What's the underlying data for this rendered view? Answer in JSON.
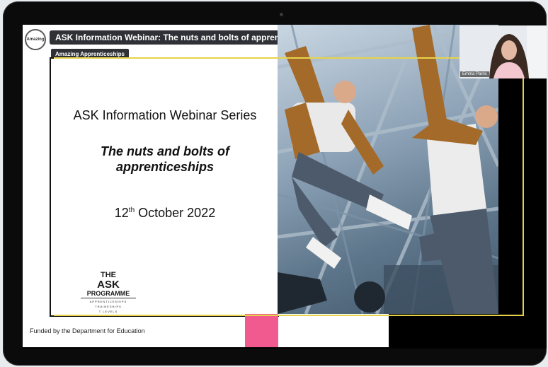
{
  "slide": {
    "header_title": "ASK Information Webinar: The nuts and bolts of apprenticeships",
    "org_tag": "Amazing Apprenticeships",
    "logo_text": "Amazing",
    "series_title": "ASK Information Webinar Series",
    "talk_title": "The nuts and bolts of apprenticeships",
    "date_day": "12",
    "date_suffix": "th",
    "date_rest": " October 2022",
    "ask_logo": {
      "line1": "THE",
      "line2": "ASK",
      "line3": "PROGRAMME",
      "line4": "APPRENTICESHIPS",
      "line5": "TRAINESHIPS",
      "line6": "T LEVELS"
    },
    "footer": "Funded by the Department for Education"
  },
  "video": {
    "participant_name": "Emma Parris"
  },
  "colors": {
    "accent_yellow": "#e6d34a",
    "accent_pink": "#f05a8f",
    "tag_bg": "#2f3136"
  }
}
